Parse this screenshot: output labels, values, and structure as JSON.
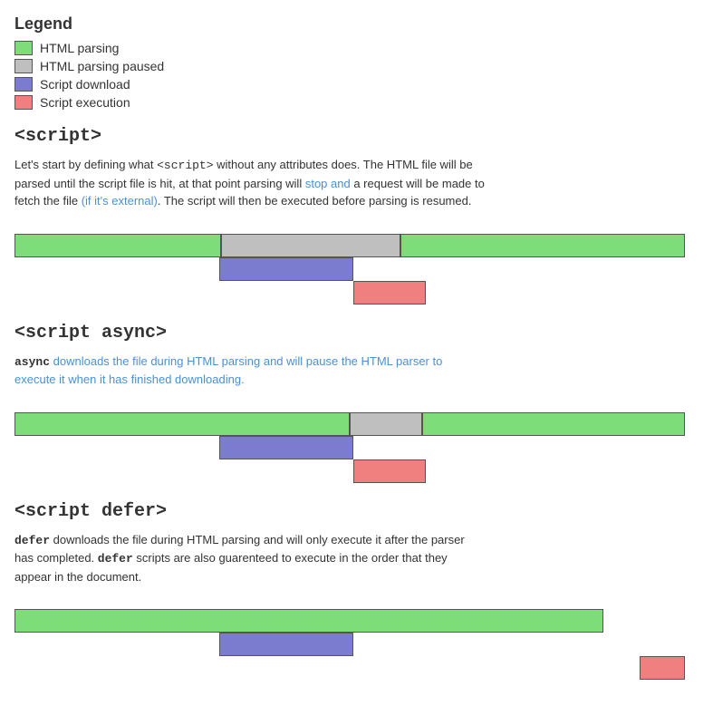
{
  "legend": {
    "title": "Legend",
    "items": [
      {
        "label": "HTML parsing",
        "color_class": "bg-green"
      },
      {
        "label": "HTML parsing paused",
        "color_class": "bg-gray"
      },
      {
        "label": "Script download",
        "color_class": "bg-blue"
      },
      {
        "label": "Script execution",
        "color_class": "bg-pink"
      }
    ]
  },
  "sections": [
    {
      "id": "script",
      "title": "<script>",
      "desc_parts": [
        {
          "text": "Let's start by defining what ",
          "type": "plain"
        },
        {
          "text": "<script>",
          "type": "code"
        },
        {
          "text": " without any attributes does. The HTML file will be parsed until the script file is hit, at that point parsing will stop and a request will be made to fetch the file (if it's external). The script will then be executed before parsing is resumed.",
          "type": "plain"
        }
      ]
    },
    {
      "id": "script-async",
      "title": "<script async>",
      "desc_parts": [
        {
          "text": "async",
          "type": "code-bold"
        },
        {
          "text": " downloads the file during HTML parsing and will pause the HTML parser to execute it when it has finished downloading.",
          "type": "plain"
        }
      ]
    },
    {
      "id": "script-defer",
      "title": "<script defer>",
      "desc_parts": [
        {
          "text": "defer",
          "type": "code-bold"
        },
        {
          "text": " downloads the file during HTML parsing and will only execute it after the parser has completed. ",
          "type": "plain"
        },
        {
          "text": "defer",
          "type": "code-bold"
        },
        {
          "text": " scripts are also guarenteed to execute in the order that they appear in the document.",
          "type": "plain"
        }
      ]
    }
  ]
}
